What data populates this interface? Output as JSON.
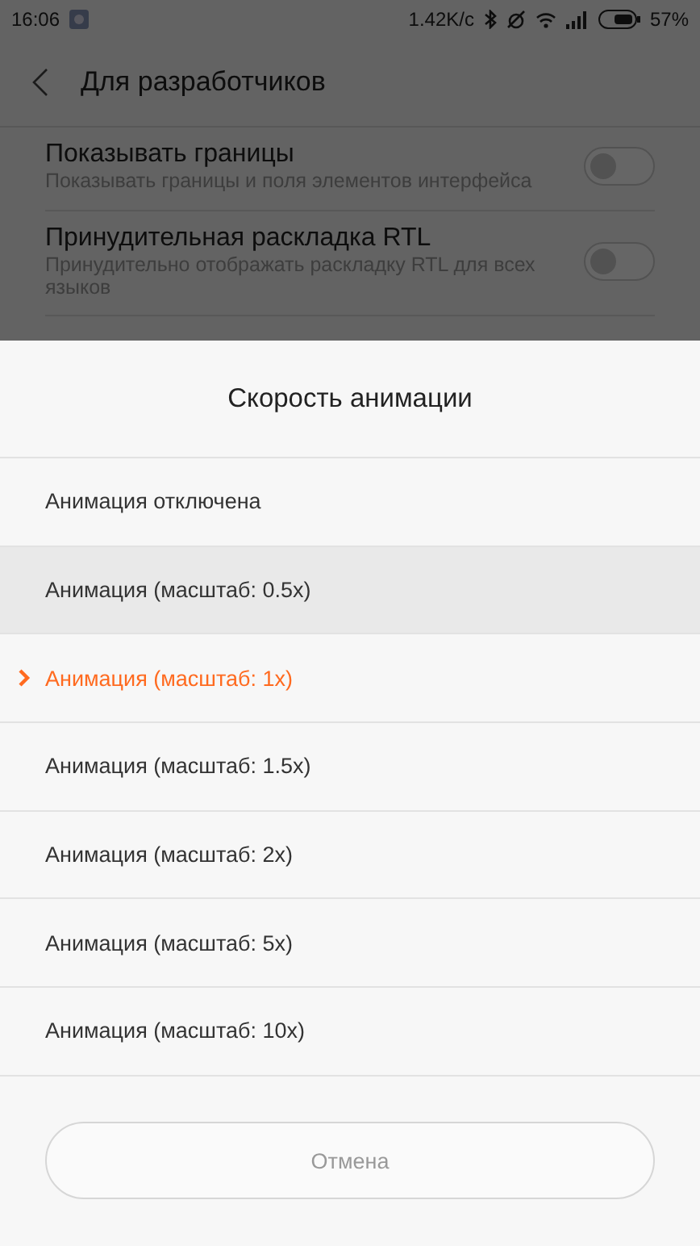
{
  "status_bar": {
    "time": "16:06",
    "speed": "1.42K/c",
    "battery_percent": "57%"
  },
  "header": {
    "title": "Для разработчиков"
  },
  "settings": [
    {
      "title": "Показывать границы",
      "subtitle": "Показывать границы и поля элементов интерфейса",
      "on": false
    },
    {
      "title": "Принудительная раскладка RTL",
      "subtitle": "Принудительно отображать раскладку RTL для всех языков",
      "on": false
    }
  ],
  "dialog": {
    "title": "Скорость анимации",
    "options": [
      {
        "label": "Анимация отключена",
        "selected": false,
        "pressed": false
      },
      {
        "label": "Анимация (масштаб: 0.5x)",
        "selected": false,
        "pressed": true
      },
      {
        "label": "Анимация (масштаб: 1x)",
        "selected": true,
        "pressed": false
      },
      {
        "label": "Анимация (масштаб: 1.5x)",
        "selected": false,
        "pressed": false
      },
      {
        "label": "Анимация (масштаб: 2x)",
        "selected": false,
        "pressed": false
      },
      {
        "label": "Анимация (масштаб: 5x)",
        "selected": false,
        "pressed": false
      },
      {
        "label": "Анимация (масштаб: 10x)",
        "selected": false,
        "pressed": false
      }
    ],
    "cancel": "Отмена"
  }
}
